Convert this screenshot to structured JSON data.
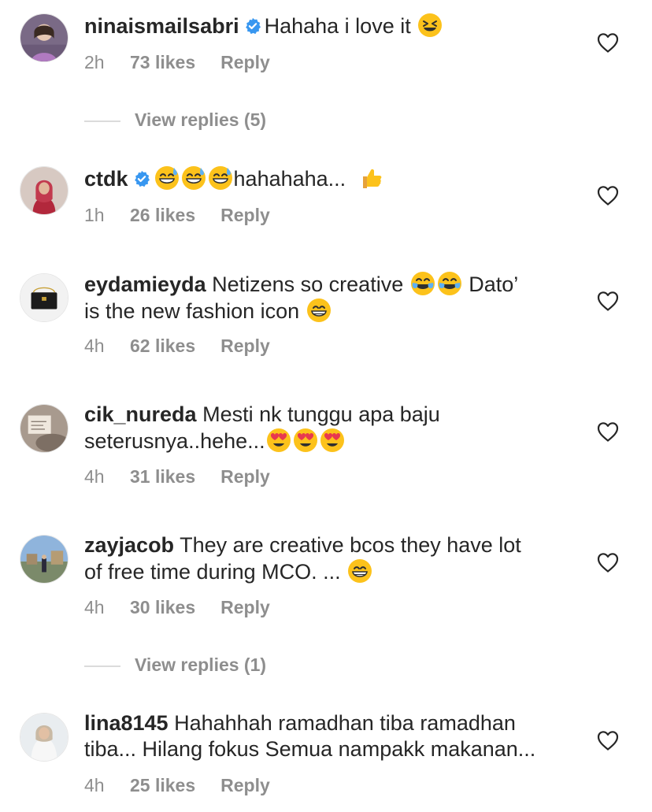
{
  "comments": [
    {
      "username": "ninaismailsabri",
      "verified": true,
      "text": "Hahaha i love it",
      "time": "2h",
      "likes": "73 likes",
      "reply": "Reply"
    },
    {
      "username": "ctdk",
      "verified": true,
      "text": "hahahaha...",
      "time": "1h",
      "likes": "26 likes",
      "reply": "Reply"
    },
    {
      "username": "eydamieyda",
      "verified": false,
      "text_a": "Netizens so creative",
      "text_b": "Dato’",
      "text_c": "is the new fashion icon",
      "time": "4h",
      "likes": "62 likes",
      "reply": "Reply"
    },
    {
      "username": "cik_nureda",
      "verified": false,
      "text_a": "Mesti nk tunggu apa baju",
      "text_b": "seterusnya..hehe...",
      "time": "4h",
      "likes": "31 likes",
      "reply": "Reply"
    },
    {
      "username": "zayjacob",
      "verified": false,
      "text_a": "They are creative bcos  they have lot",
      "text_b": "of free time during MCO. ...",
      "time": "4h",
      "likes": "30 likes",
      "reply": "Reply"
    },
    {
      "username": "lina8145",
      "verified": false,
      "text_a": "Hahahhah ramadhan tiba ramadhan",
      "text_b": "tiba... Hilang fokus Semua nampakk makanan...",
      "time": "4h",
      "likes": "25 likes",
      "reply": "Reply"
    }
  ],
  "view_replies": [
    "View replies (5)",
    "View replies (1)"
  ],
  "icons": {
    "heart": "heart-outline-icon",
    "verified": "verified-badge-icon"
  },
  "colors": {
    "verified": "#3897f0",
    "meta": "#8e8e8e",
    "text": "#262626"
  }
}
